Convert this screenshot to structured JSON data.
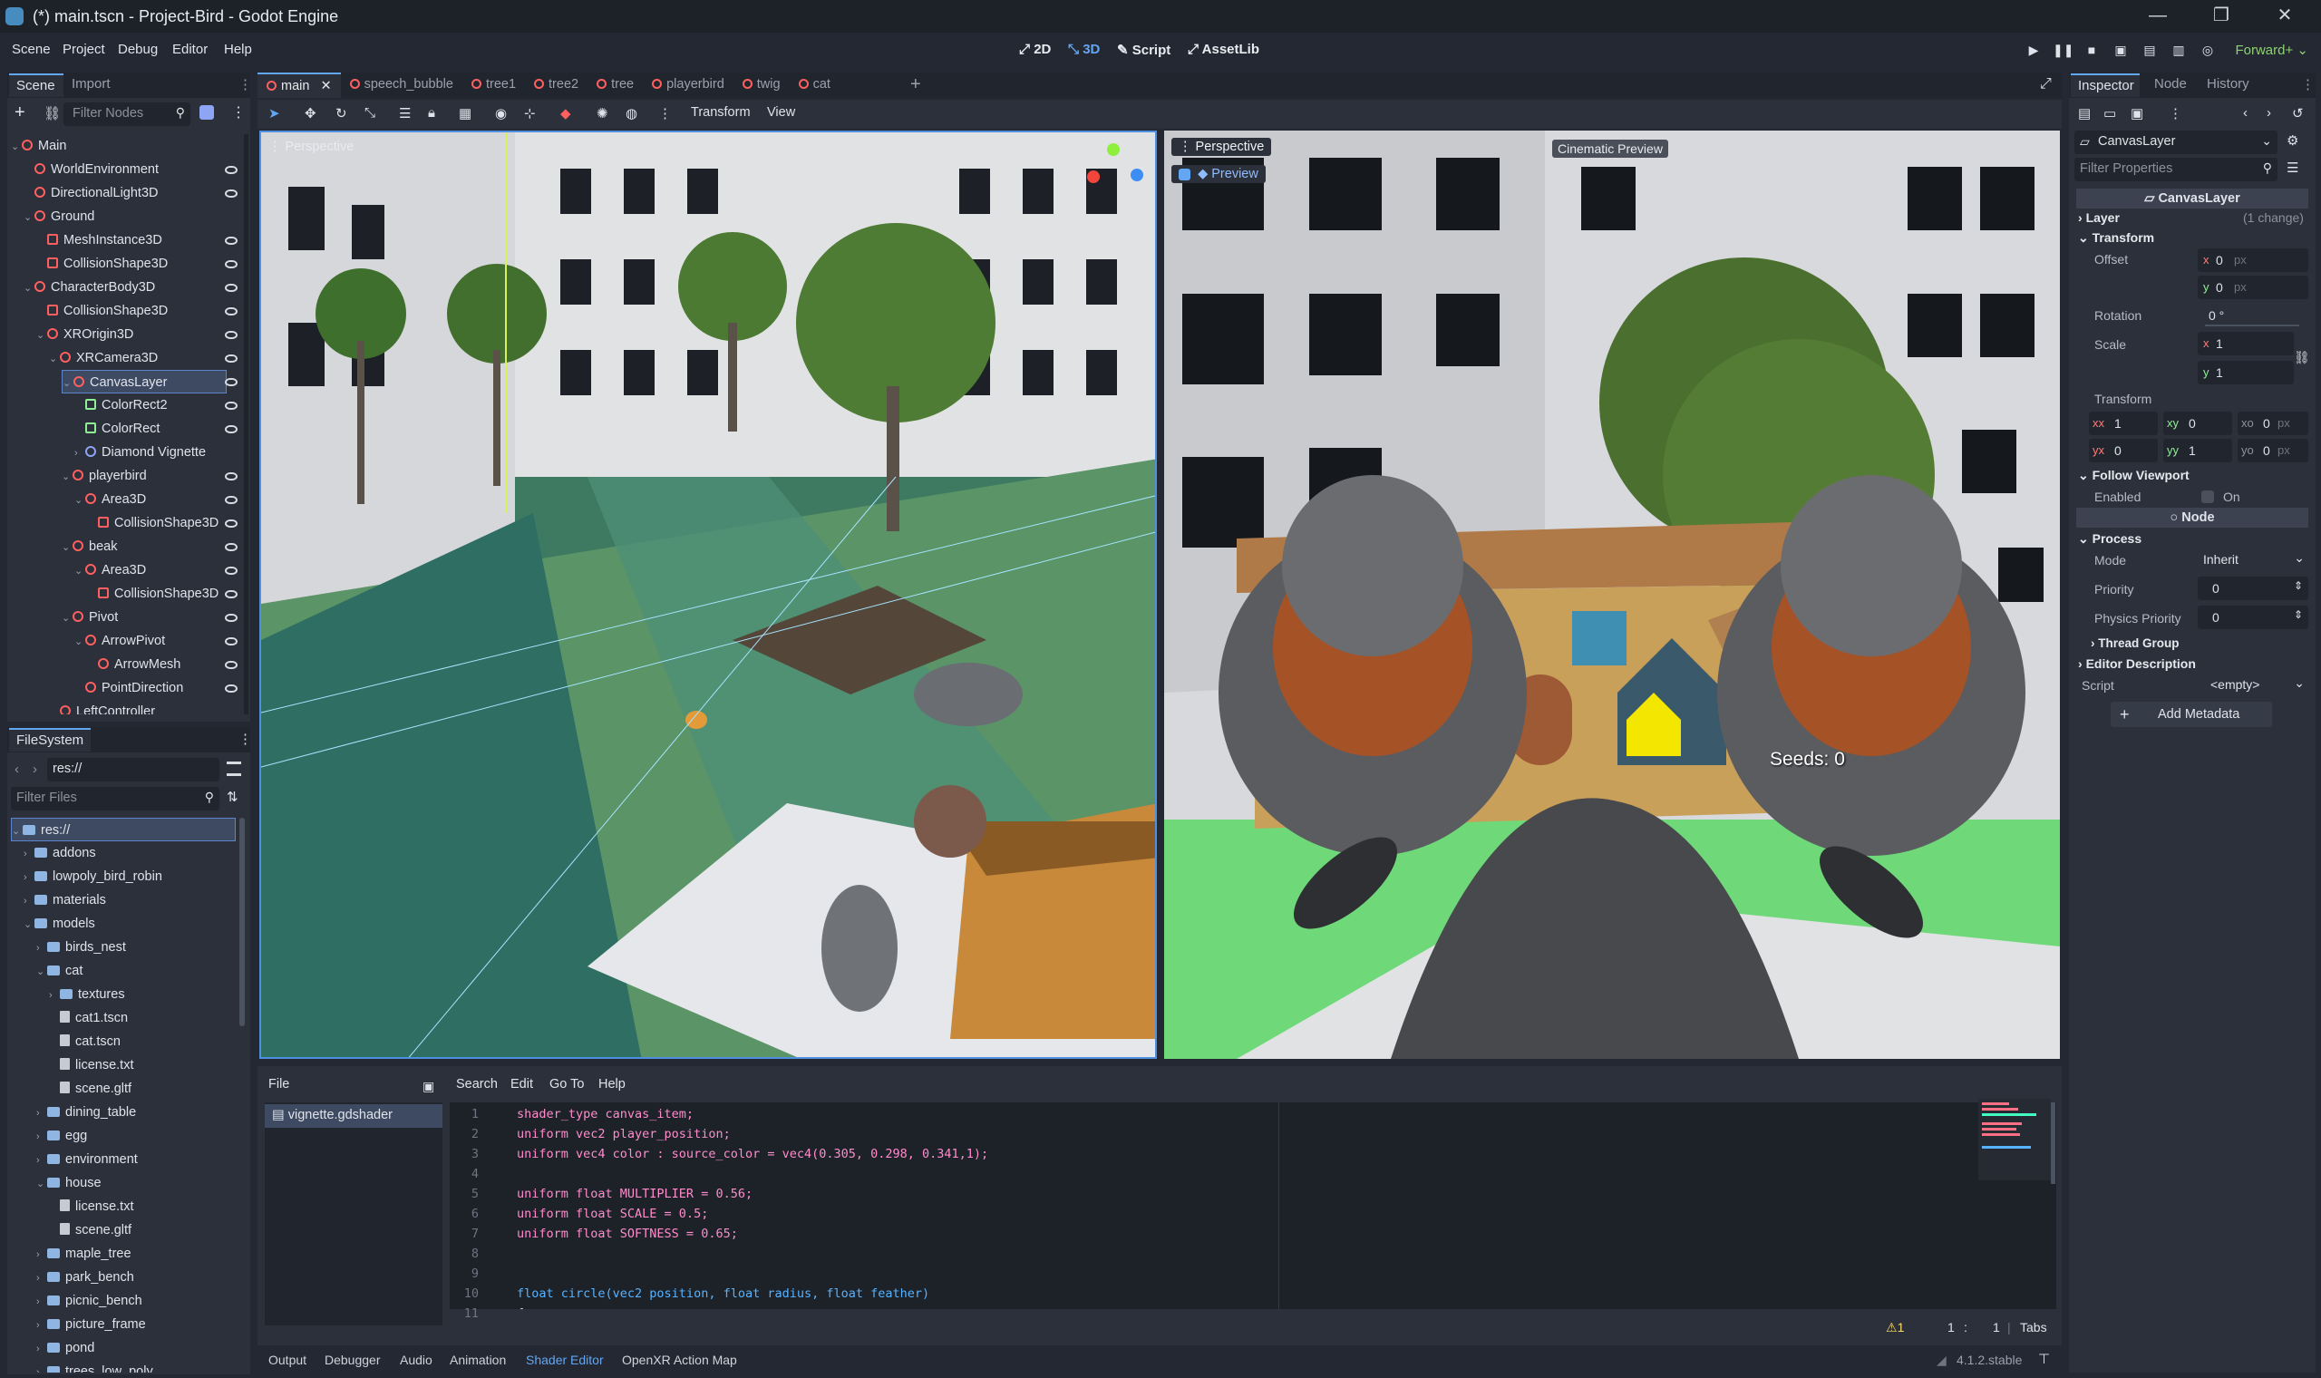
{
  "window": {
    "title": "(*) main.tscn - Project-Bird - Godot Engine"
  },
  "menu": [
    "Scene",
    "Project",
    "Debug",
    "Editor",
    "Help"
  ],
  "modes": {
    "m2d": "2D",
    "m3d": "3D",
    "script": "Script",
    "assetlib": "AssetLib"
  },
  "renderer": "Forward+",
  "scene_dock": {
    "tabs": [
      "Scene",
      "Import"
    ],
    "filter_placeholder": "Filter Nodes",
    "nodes": [
      {
        "label": "Main",
        "indent": 0
      },
      {
        "label": "WorldEnvironment",
        "indent": 1
      },
      {
        "label": "DirectionalLight3D",
        "indent": 1
      },
      {
        "label": "Ground",
        "indent": 1
      },
      {
        "label": "MeshInstance3D",
        "indent": 2
      },
      {
        "label": "CollisionShape3D",
        "indent": 2
      },
      {
        "label": "CharacterBody3D",
        "indent": 1
      },
      {
        "label": "CollisionShape3D",
        "indent": 2
      },
      {
        "label": "XROrigin3D",
        "indent": 2
      },
      {
        "label": "XRCamera3D",
        "indent": 3
      },
      {
        "label": "CanvasLayer",
        "indent": 4
      },
      {
        "label": "ColorRect2",
        "indent": 5
      },
      {
        "label": "ColorRect",
        "indent": 5
      },
      {
        "label": "Diamond Vignette",
        "indent": 5
      },
      {
        "label": "playerbird",
        "indent": 4
      },
      {
        "label": "Area3D",
        "indent": 5
      },
      {
        "label": "CollisionShape3D",
        "indent": 6
      },
      {
        "label": "beak",
        "indent": 4
      },
      {
        "label": "Area3D",
        "indent": 5
      },
      {
        "label": "CollisionShape3D",
        "indent": 6
      },
      {
        "label": "Pivot",
        "indent": 4
      },
      {
        "label": "ArrowPivot",
        "indent": 5
      },
      {
        "label": "ArrowMesh",
        "indent": 6
      },
      {
        "label": "PointDirection",
        "indent": 5
      },
      {
        "label": "LeftController",
        "indent": 3
      }
    ]
  },
  "filesystem": {
    "title": "FileSystem",
    "path": "res://",
    "filter_placeholder": "Filter Files",
    "items": [
      {
        "label": "res://",
        "indent": 0,
        "kind": "folder"
      },
      {
        "label": "addons",
        "indent": 1,
        "kind": "folder"
      },
      {
        "label": "lowpoly_bird_robin",
        "indent": 1,
        "kind": "folder"
      },
      {
        "label": "materials",
        "indent": 1,
        "kind": "folder"
      },
      {
        "label": "models",
        "indent": 1,
        "kind": "folder"
      },
      {
        "label": "birds_nest",
        "indent": 2,
        "kind": "folder"
      },
      {
        "label": "cat",
        "indent": 2,
        "kind": "folder"
      },
      {
        "label": "textures",
        "indent": 3,
        "kind": "folder"
      },
      {
        "label": "cat1.tscn",
        "indent": 3,
        "kind": "file"
      },
      {
        "label": "cat.tscn",
        "indent": 3,
        "kind": "file"
      },
      {
        "label": "license.txt",
        "indent": 3,
        "kind": "file"
      },
      {
        "label": "scene.gltf",
        "indent": 3,
        "kind": "file"
      },
      {
        "label": "dining_table",
        "indent": 2,
        "kind": "folder"
      },
      {
        "label": "egg",
        "indent": 2,
        "kind": "folder"
      },
      {
        "label": "environment",
        "indent": 2,
        "kind": "folder"
      },
      {
        "label": "house",
        "indent": 2,
        "kind": "folder"
      },
      {
        "label": "license.txt",
        "indent": 3,
        "kind": "file"
      },
      {
        "label": "scene.gltf",
        "indent": 3,
        "kind": "file"
      },
      {
        "label": "maple_tree",
        "indent": 2,
        "kind": "folder"
      },
      {
        "label": "park_bench",
        "indent": 2,
        "kind": "folder"
      },
      {
        "label": "picnic_bench",
        "indent": 2,
        "kind": "folder"
      },
      {
        "label": "picture_frame",
        "indent": 2,
        "kind": "folder"
      },
      {
        "label": "pond",
        "indent": 2,
        "kind": "folder"
      },
      {
        "label": "trees_low_poly",
        "indent": 2,
        "kind": "folder"
      }
    ]
  },
  "scene_tabs": [
    "main",
    "speech_bubble",
    "tree1",
    "tree2",
    "tree",
    "playerbird",
    "twig",
    "cat"
  ],
  "viewport_toolbar": {
    "transform": "Transform",
    "view": "View"
  },
  "viewport_left": {
    "label": "Perspective"
  },
  "viewport_right": {
    "label": "Perspective",
    "preview": "Preview",
    "cinematic": "Cinematic Preview",
    "seeds": "Seeds: 0"
  },
  "shader_editor": {
    "menu": [
      "File",
      "Search",
      "Edit",
      "Go To",
      "Help"
    ],
    "file": "vignette.gdshader",
    "lines": [
      "1",
      "2",
      "3",
      "4",
      "5",
      "6",
      "7",
      "8",
      "9",
      "10",
      "11"
    ],
    "code": [
      "shader_type canvas_item;",
      "uniform vec2 player_position;",
      "uniform vec4 color : source_color = vec4(0.305, 0.298, 0.341,1);",
      "",
      "uniform float MULTIPLIER = 0.56;",
      "uniform float SCALE = 0.5;",
      "uniform float SOFTNESS = 0.65;",
      "",
      "",
      "float circle(vec2 position, float radius, float feather)",
      "{"
    ],
    "status": {
      "warnings": "1",
      "line": "1",
      "col": "1",
      "indent": "Tabs"
    }
  },
  "bottom_tabs": [
    "Output",
    "Debugger",
    "Audio",
    "Animation",
    "Shader Editor",
    "OpenXR Action Map"
  ],
  "version": "4.1.2.stable",
  "inspector": {
    "tabs": [
      "Inspector",
      "Node",
      "History"
    ],
    "node": "CanvasLayer",
    "filter_placeholder": "Filter Properties",
    "class_header": "CanvasLayer",
    "layer": "Layer",
    "layer_note": "(1 change)",
    "transform": "Transform",
    "offset": "Offset",
    "offset_x": "0",
    "offset_y": "0",
    "px": "px",
    "rotation": "Rotation",
    "rotation_val": "0 °",
    "scale": "Scale",
    "scale_x": "1",
    "scale_y": "1",
    "transform2": "Transform",
    "xx": "1",
    "xy": "0",
    "xo": "0",
    "yx": "0",
    "yy": "1",
    "yo": "0",
    "follow_viewport": "Follow Viewport",
    "enabled": "Enabled",
    "on": "On",
    "node_header": "Node",
    "process": "Process",
    "mode": "Mode",
    "mode_val": "Inherit",
    "priority": "Priority",
    "priority_val": "0",
    "physics_priority": "Physics Priority",
    "physics_priority_val": "0",
    "thread_group": "Thread Group",
    "editor_description": "Editor Description",
    "script": "Script",
    "script_val": "<empty>",
    "add_metadata": "Add Metadata"
  }
}
